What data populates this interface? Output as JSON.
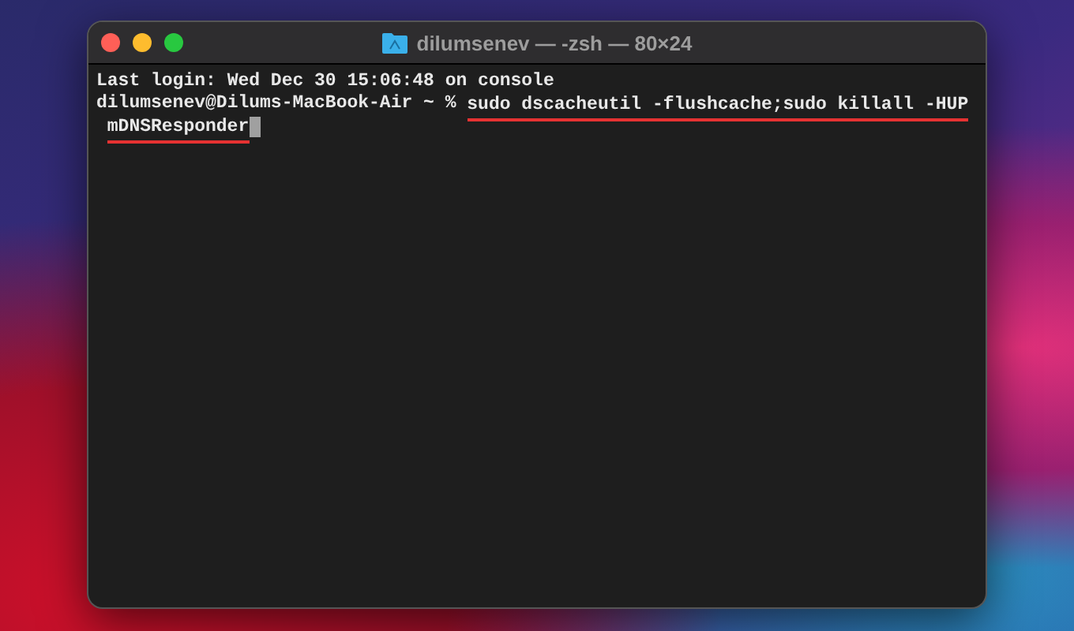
{
  "window": {
    "title": "dilumsenev — -zsh — 80×24"
  },
  "terminal": {
    "lines": [
      {
        "segments": [
          {
            "text": "Last login: Wed Dec 30 15:06:48 on console",
            "underlined": false
          }
        ],
        "cursor": false
      },
      {
        "segments": [
          {
            "text": "dilumsenev@Dilums-MacBook-Air ~ % ",
            "underlined": false
          },
          {
            "text": "sudo dscacheutil -flushcache;sudo killall -HUP",
            "underlined": true
          }
        ],
        "cursor": false
      },
      {
        "segments": [
          {
            "text": "mDNSResponder",
            "underlined": true
          }
        ],
        "cursor": true,
        "wrapped": true
      }
    ]
  }
}
